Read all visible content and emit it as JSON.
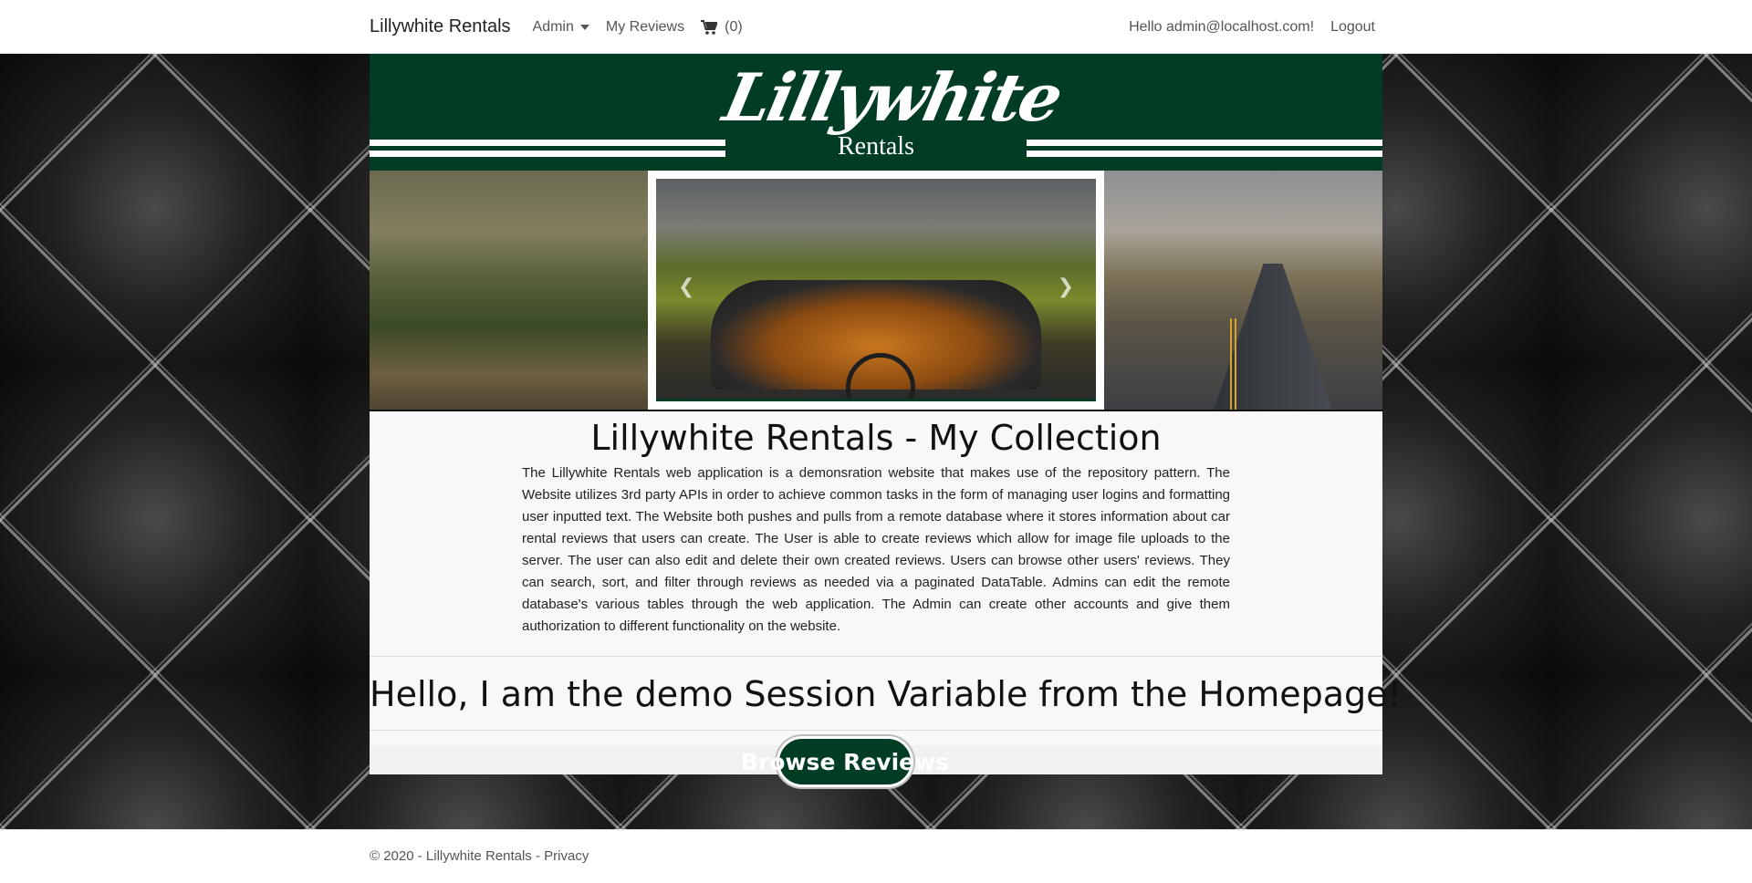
{
  "nav": {
    "brand": "Lillywhite Rentals",
    "admin_label": "Admin",
    "my_reviews_label": "My Reviews",
    "cart_count": "(0)",
    "hello": "Hello admin@localhost.com!",
    "logout": "Logout"
  },
  "banner": {
    "logo_script": "Lillywhite",
    "logo_sub": "Rentals"
  },
  "main": {
    "title": "Lillywhite Rentals - My Collection",
    "description": "The Lillywhite Rentals web application is a demonsration website that makes use of the repository pattern. The Website utilizes 3rd party APIs in order to achieve common tasks in the form of managing user logins and formatting user inputted text. The Website both pushes and pulls from a remote database where it stores information about car rental reviews that users can create. The User is able to create reviews which allow for image file uploads to the server. The user can also edit and delete their own created reviews. Users can browse other users' reviews. They can search, sort, and filter through reviews as needed via a paginated DataTable. Admins can edit the remote database's various tables through the web application. The Admin can create other accounts and give them authorization to different functionality on the website.",
    "session_text": "Hello, I am the demo Session Variable from the Homepage!",
    "browse_button": "Browse Reviews"
  },
  "carousel": {
    "prev_icon": "chevron-left-icon",
    "next_icon": "chevron-right-icon"
  },
  "footer": {
    "copyright": "© 2020 - Lillywhite Rentals - ",
    "privacy": "Privacy"
  },
  "colors": {
    "brand_green": "#003d24"
  }
}
